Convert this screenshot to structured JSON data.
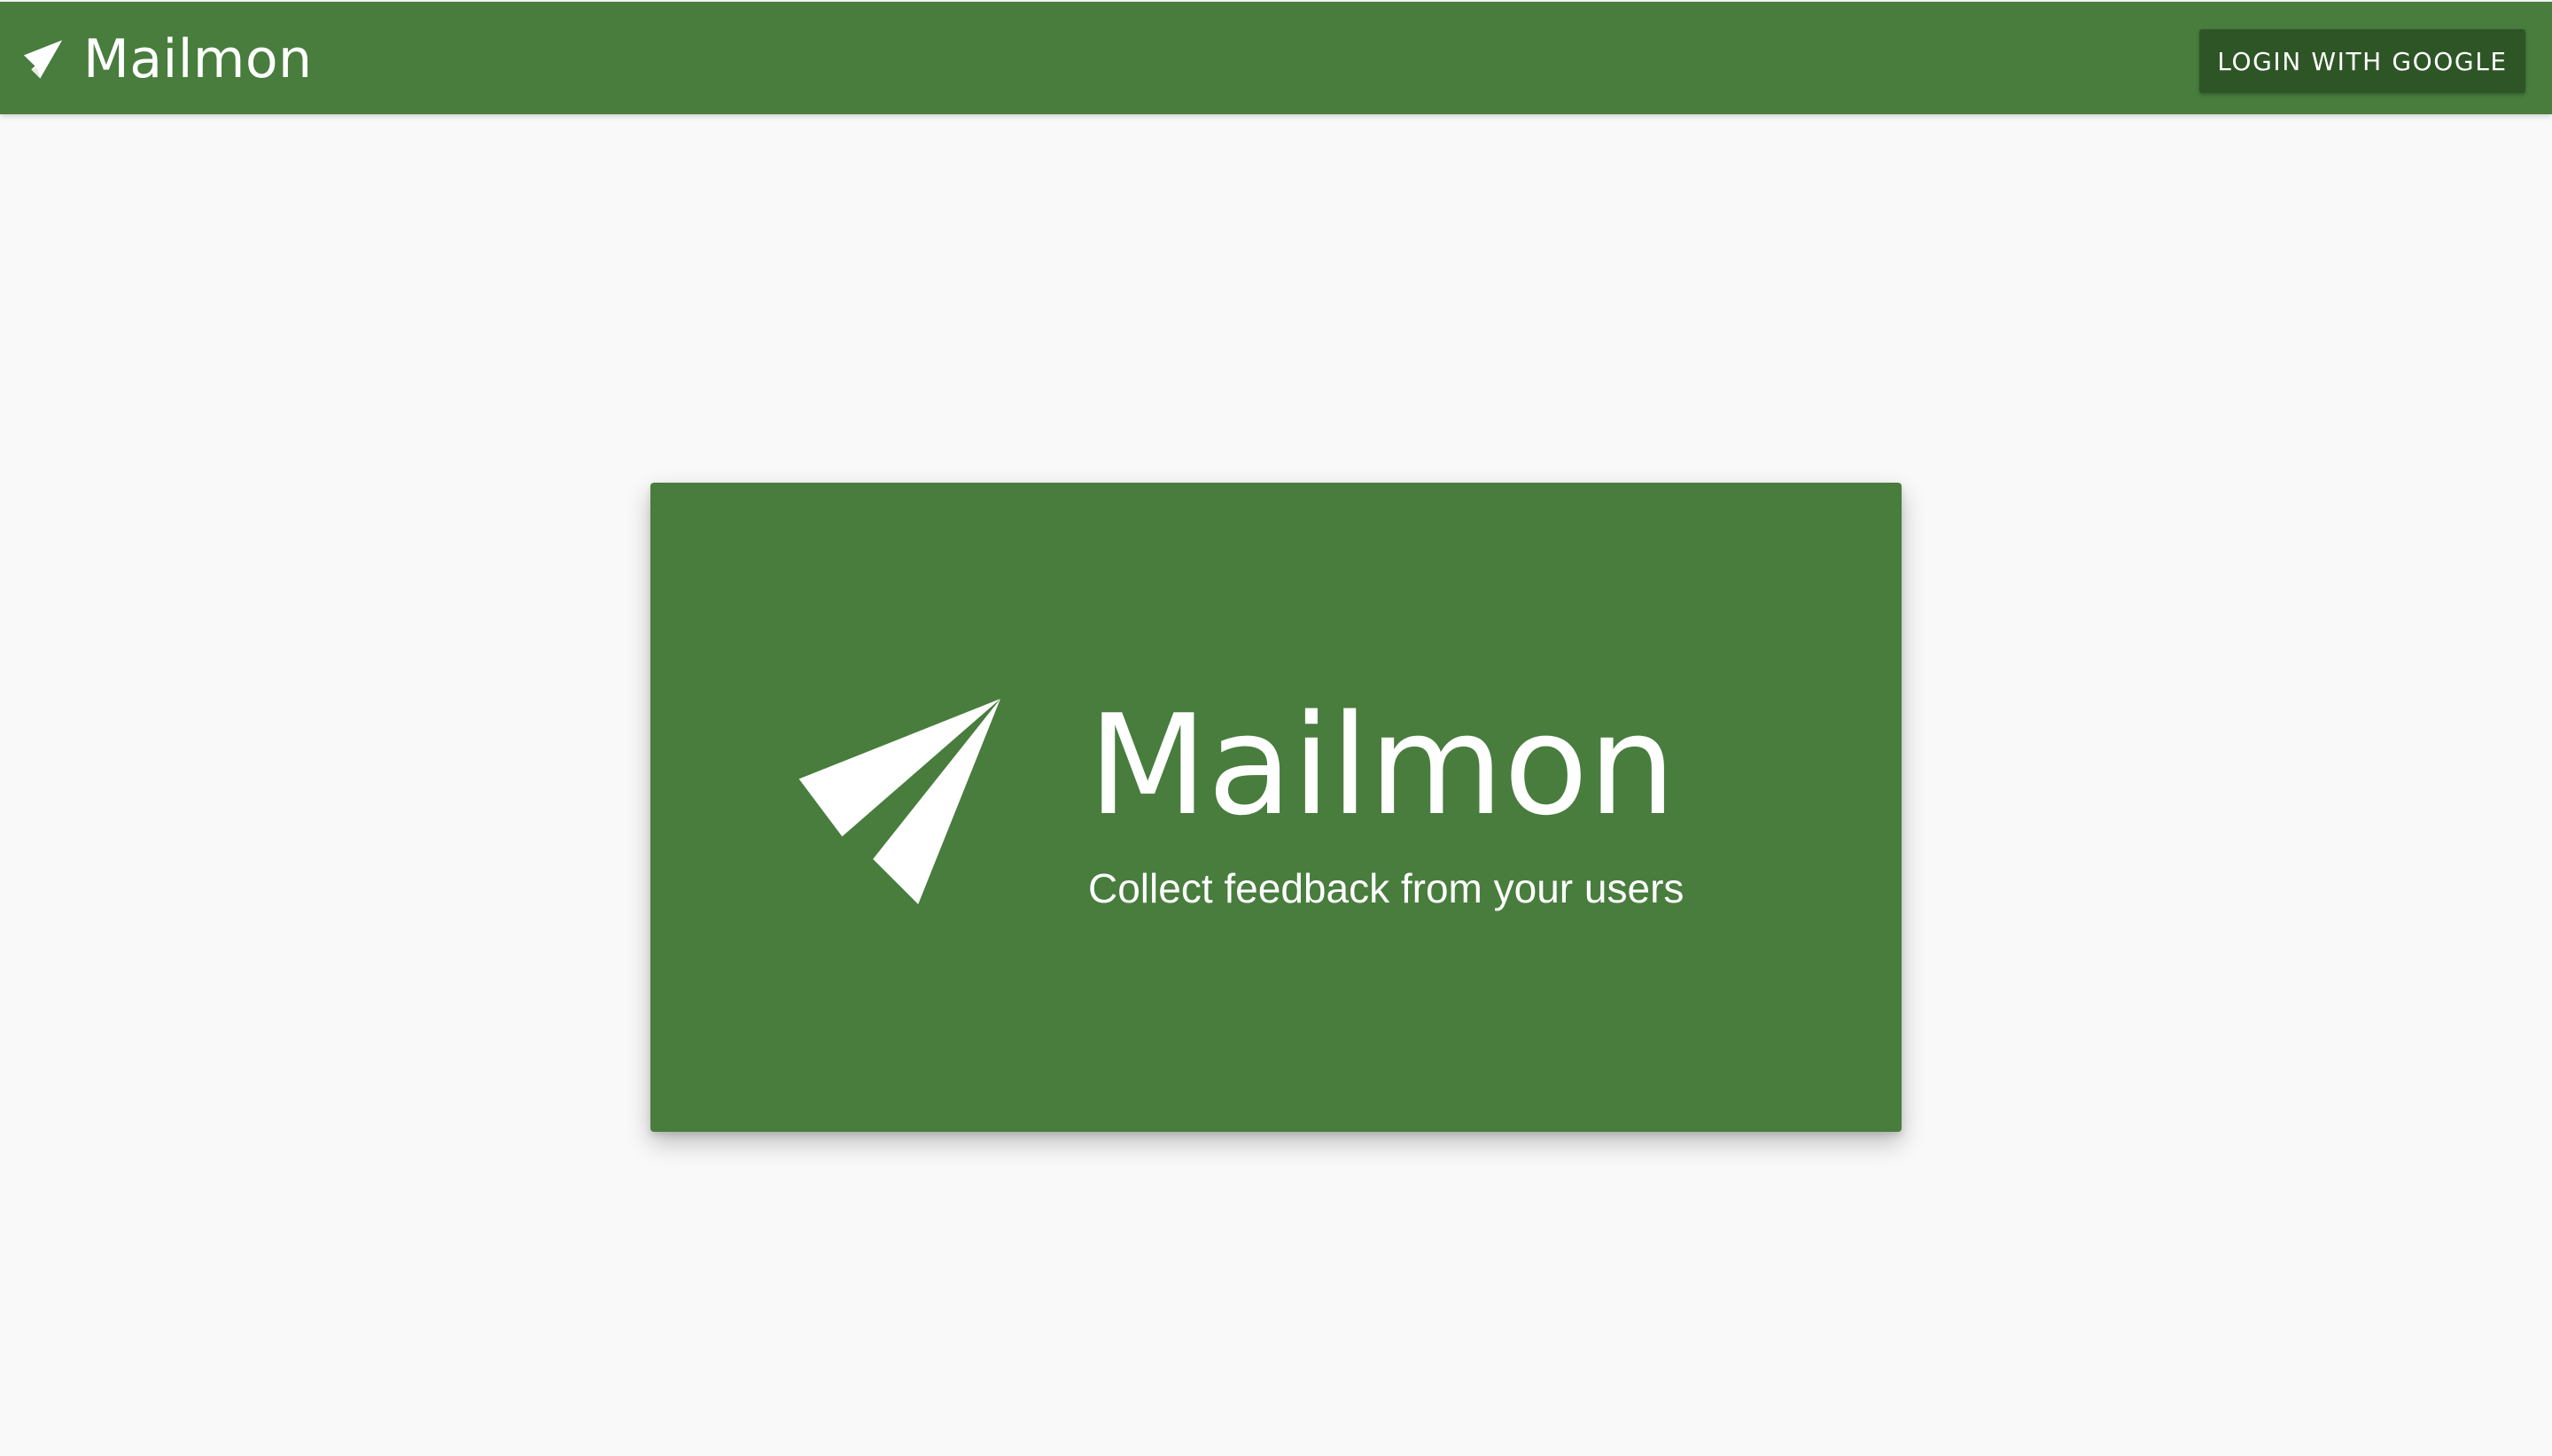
{
  "header": {
    "app_name": "Mailmon",
    "login_label": "LOGIN WITH GOOGLE",
    "logo_icon": "paper-plane-icon"
  },
  "hero": {
    "title": "Mailmon",
    "subtitle": "Collect feedback from your users",
    "logo_icon": "paper-plane-icon"
  },
  "colors": {
    "primary": "#487d3d",
    "button": "#2e5526",
    "background": "#f9f9f9",
    "text_on_primary": "#ffffff"
  }
}
